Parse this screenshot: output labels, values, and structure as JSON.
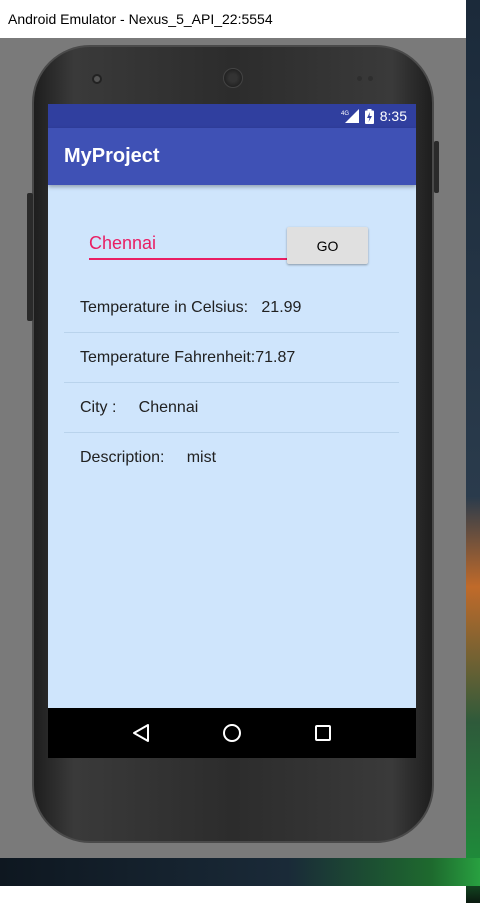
{
  "window": {
    "title": "Android Emulator - Nexus_5_API_22:5554"
  },
  "status_bar": {
    "network": "4G",
    "time": "8:35"
  },
  "app": {
    "title": "MyProject"
  },
  "search": {
    "value": "Chennai",
    "go_label": "GO"
  },
  "weather": {
    "rows": [
      {
        "label": "Temperature in Celsius:   ",
        "value": "21.99"
      },
      {
        "label": "Temperature Fahrenheit:",
        "value": "71.87"
      },
      {
        "label": "City :     ",
        "value": "Chennai"
      },
      {
        "label": "Description:     ",
        "value": "mist"
      }
    ]
  },
  "nav": {
    "back_icon": "back-triangle-icon",
    "home_icon": "home-circle-icon",
    "recents_icon": "recents-square-icon"
  },
  "colors": {
    "primary": "#3f51b5",
    "primary_dark": "#303f9f",
    "accent": "#e91e63",
    "screen_bg": "#cfe5fc"
  }
}
